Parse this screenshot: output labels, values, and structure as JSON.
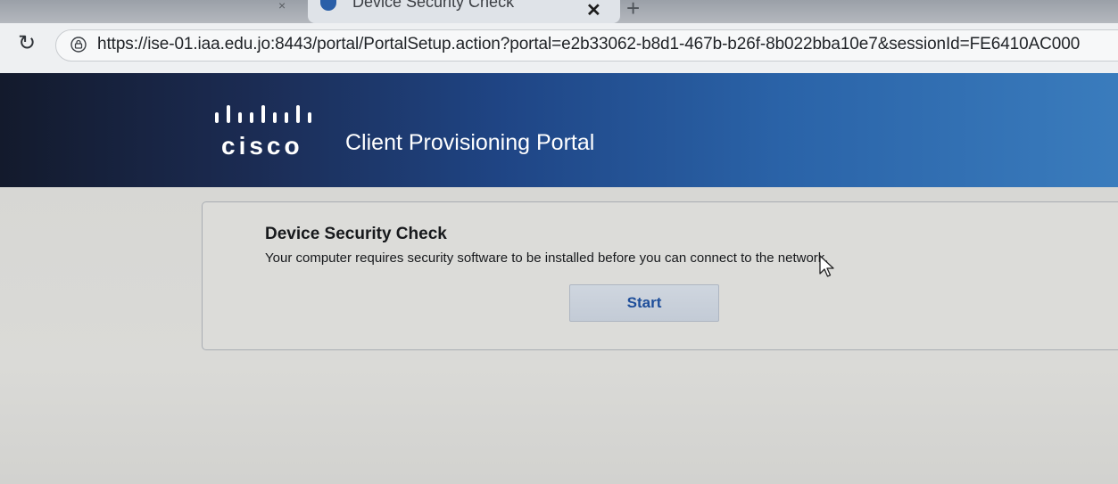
{
  "browser": {
    "tab": {
      "title": "Device Security Check",
      "close_glyph": "✕",
      "prev_close_glyph": "×"
    },
    "new_tab_glyph": "+",
    "reload_glyph": "↻",
    "url": "https://ise-01.iaa.edu.jo:8443/portal/PortalSetup.action?portal=e2b33062-b8d1-467b-b26f-8b022bba10e7&sessionId=FE6410AC000"
  },
  "header": {
    "brand": "cisco",
    "title": "Client Provisioning Portal"
  },
  "main": {
    "heading": "Device Security Check",
    "message": "Your computer requires security software to be installed before you can connect to the network.",
    "start_label": "Start"
  },
  "icons": {
    "reload": "reload-icon",
    "lock": "lock-icon",
    "new_tab": "plus-icon",
    "logo": "cisco-logo-icon",
    "cursor": "mouse-pointer-icon"
  },
  "colors": {
    "header_dark": "#131a2c",
    "header_light": "#3a7cbd",
    "button_text": "#1e4e9a"
  }
}
